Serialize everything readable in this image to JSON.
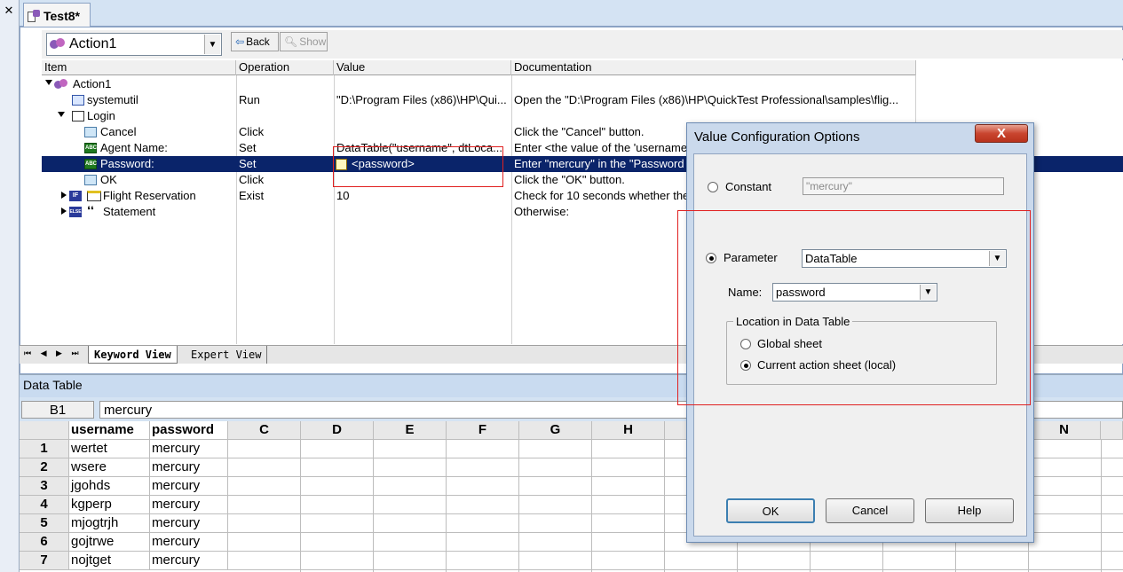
{
  "window": {
    "close_glyph": "✕",
    "doc_tab": "Test8*"
  },
  "toolbar": {
    "action_combo": "Action1",
    "back_label": "Back",
    "show_label": "Show"
  },
  "grid": {
    "headers": [
      "Item",
      "Operation",
      "Value",
      "Documentation"
    ],
    "rows": [
      {
        "item": "Action1",
        "operation": "",
        "value": "",
        "doc": ""
      },
      {
        "item": "systemutil",
        "operation": "Run",
        "value": "\"D:\\Program Files (x86)\\HP\\Qui...",
        "doc": "Open the \"D:\\Program Files (x86)\\HP\\QuickTest Professional\\samples\\flig..."
      },
      {
        "item": "Login",
        "operation": "",
        "value": "",
        "doc": ""
      },
      {
        "item": "Cancel",
        "operation": "Click",
        "value": "",
        "doc": "Click the \"Cancel\" button."
      },
      {
        "item": "Agent Name:",
        "operation": "Set",
        "value": "DataTable(\"username\", dtLoca...",
        "doc": "Enter <the value of the 'username"
      },
      {
        "item": "Password:",
        "operation": "Set",
        "value": "<password>",
        "doc": "Enter \"mercury\" in the \"Password"
      },
      {
        "item": "OK",
        "operation": "Click",
        "value": "",
        "doc": "Click the \"OK\" button."
      },
      {
        "item": "Flight Reservation",
        "operation": "Exist",
        "value": "10",
        "doc": "Check for 10 seconds whether the"
      },
      {
        "item": "Statement",
        "operation": "",
        "value": "",
        "doc": "Otherwise:"
      }
    ],
    "icon_labels": {
      "if": "IF",
      "else": "ELSE",
      "abc": "ABC"
    }
  },
  "view_tabs": {
    "keyword": "Keyword View",
    "expert": "Expert View",
    "nav": "⏮ ◀ ▶ ⏭"
  },
  "data_table": {
    "title": "Data Table",
    "cell_ref": "B1",
    "formula": "mercury",
    "columns": [
      "username",
      "password",
      "C",
      "D",
      "E",
      "F",
      "G",
      "H",
      "N"
    ],
    "rows": [
      {
        "n": "1",
        "username": "wertet",
        "password": "mercury"
      },
      {
        "n": "2",
        "username": "wsere",
        "password": "mercury"
      },
      {
        "n": "3",
        "username": "jgohds",
        "password": "mercury"
      },
      {
        "n": "4",
        "username": "kgperp",
        "password": "mercury"
      },
      {
        "n": "5",
        "username": "mjogtrjh",
        "password": "mercury"
      },
      {
        "n": "6",
        "username": "gojtrwe",
        "password": "mercury"
      },
      {
        "n": "7",
        "username": "nojtget",
        "password": "mercury"
      }
    ]
  },
  "dialog": {
    "title": "Value Configuration Options",
    "close_glyph": "X",
    "constant_label": "Constant",
    "constant_value": "\"mercury\"",
    "parameter_label": "Parameter",
    "parameter_type": "DataTable",
    "name_label": "Name:",
    "name_value": "password",
    "location_legend": "Location in Data Table",
    "global_sheet": "Global sheet",
    "current_sheet": "Current action sheet (local)",
    "ok": "OK",
    "cancel": "Cancel",
    "help": "Help"
  }
}
